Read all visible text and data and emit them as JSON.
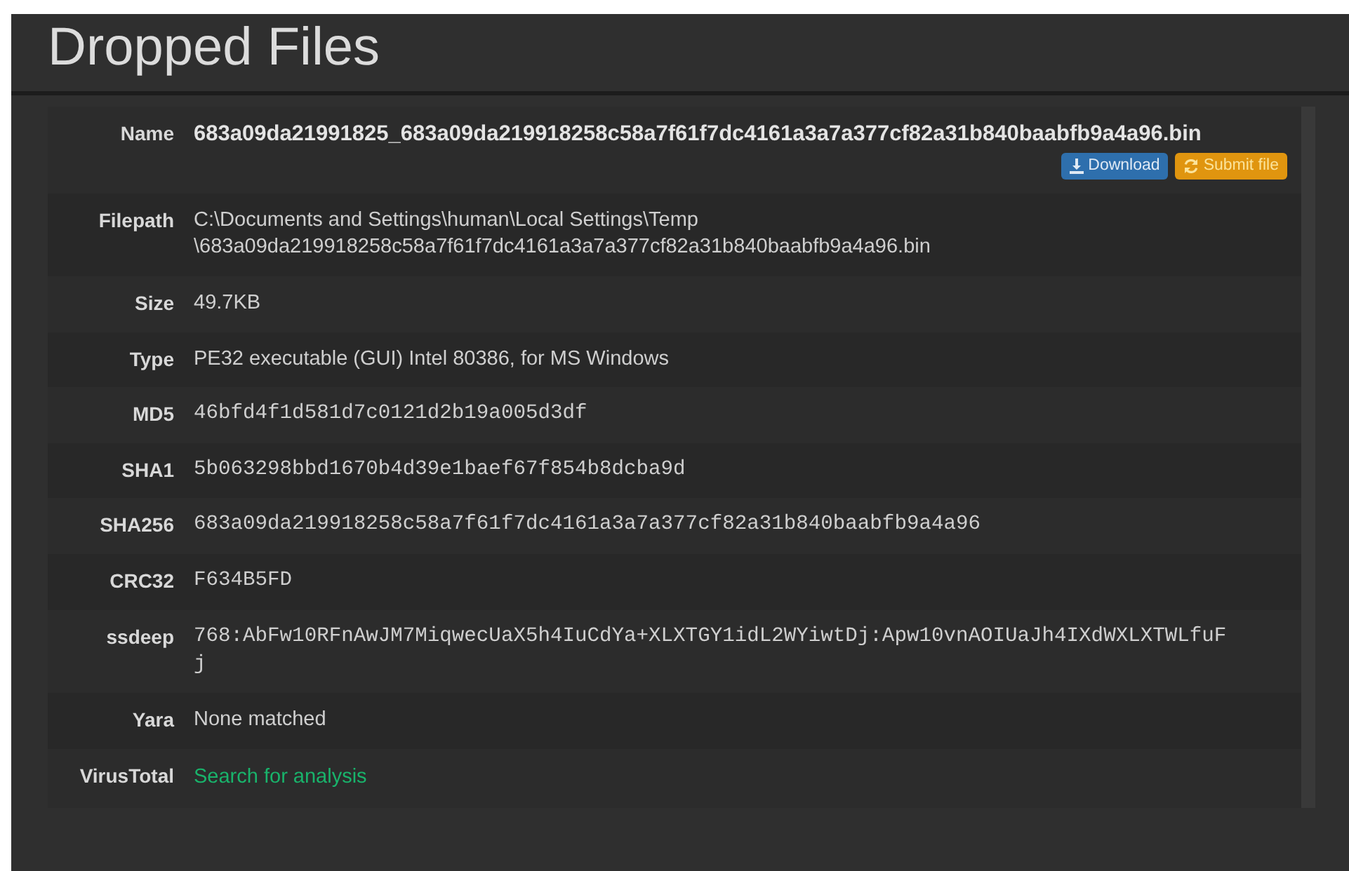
{
  "title": "Dropped Files",
  "rows": [
    {
      "label": "Name",
      "kind": "name",
      "lines": [
        "683a09da21991825_683a09da219918258c58a7f61f7dc4161a3a7a377cf82a31b840baabfb9a4a96.bin"
      ],
      "buttons": [
        {
          "label": "Download",
          "kind": "download"
        },
        {
          "label": "Submit file",
          "kind": "submit"
        }
      ]
    },
    {
      "label": "Filepath",
      "kind": "text",
      "lines": [
        "C:\\Documents and Settings\\human\\Local Settings\\Temp",
        "\\683a09da219918258c58a7f61f7dc4161a3a7a377cf82a31b840baabfb9a4a96.bin"
      ]
    },
    {
      "label": "Size",
      "kind": "text",
      "lines": [
        "49.7KB"
      ]
    },
    {
      "label": "Type",
      "kind": "text",
      "lines": [
        "PE32 executable (GUI) Intel 80386, for MS Windows"
      ]
    },
    {
      "label": "MD5",
      "kind": "mono",
      "lines": [
        "46bfd4f1d581d7c0121d2b19a005d3df"
      ]
    },
    {
      "label": "SHA1",
      "kind": "mono",
      "lines": [
        "5b063298bbd1670b4d39e1baef67f854b8dcba9d"
      ]
    },
    {
      "label": "SHA256",
      "kind": "mono",
      "lines": [
        "683a09da219918258c58a7f61f7dc4161a3a7a377cf82a31b840baabfb9a4a96"
      ]
    },
    {
      "label": "CRC32",
      "kind": "mono",
      "lines": [
        "F634B5FD"
      ]
    },
    {
      "label": "ssdeep",
      "kind": "mono",
      "lines": [
        "768:AbFw10RFnAwJM7MiqwecUaX5h4IuCdYa+XLXTGY1idL2WYiwtDj:Apw10vnAOIUaJh4IXdWXLXTWLfuF",
        "j"
      ]
    },
    {
      "label": "Yara",
      "kind": "text",
      "lines": [
        "None matched"
      ]
    },
    {
      "label": "VirusTotal",
      "kind": "link",
      "lines": [
        "Search for analysis"
      ]
    }
  ]
}
